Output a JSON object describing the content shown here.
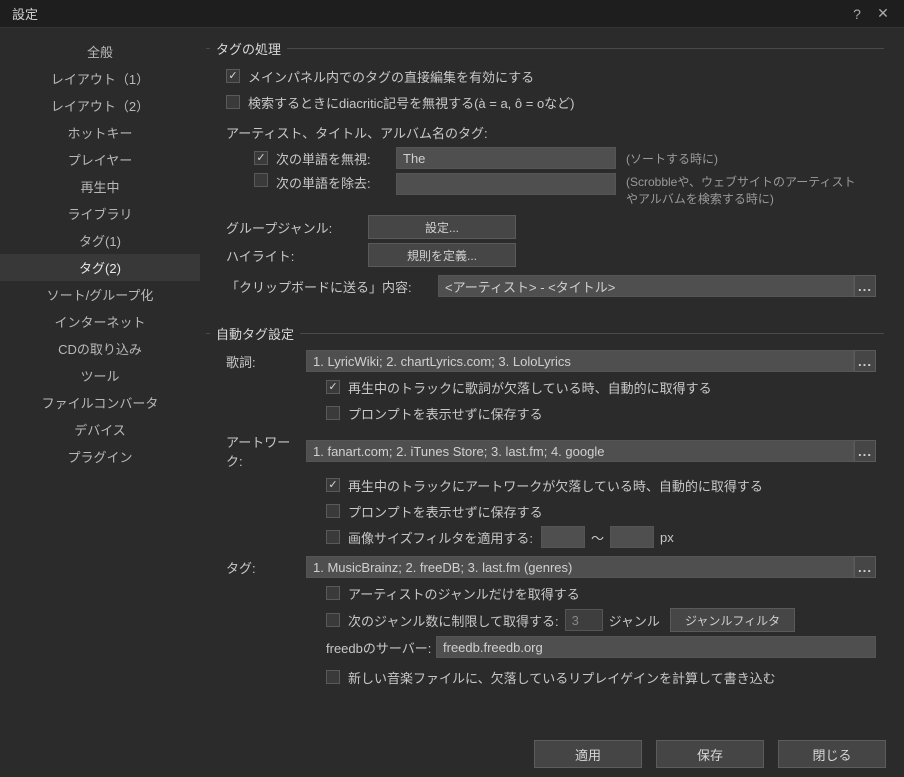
{
  "window": {
    "title": "設定"
  },
  "sidebar": {
    "items": [
      {
        "label": "全般"
      },
      {
        "label": "レイアウト（1）"
      },
      {
        "label": "レイアウト（2）"
      },
      {
        "label": "ホットキー"
      },
      {
        "label": "プレイヤー"
      },
      {
        "label": "再生中"
      },
      {
        "label": "ライブラリ"
      },
      {
        "label": "タグ(1)"
      },
      {
        "label": "タグ(2)"
      },
      {
        "label": "ソート/グループ化"
      },
      {
        "label": "インターネット"
      },
      {
        "label": "CDの取り込み"
      },
      {
        "label": "ツール"
      },
      {
        "label": "ファイルコンバータ"
      },
      {
        "label": "デバイス"
      },
      {
        "label": "プラグイン"
      }
    ],
    "selected_index": 8
  },
  "group_tag_processing": {
    "title": "タグの処理",
    "cb_direct_edit": "メインパネル内でのタグの直接編集を有効にする",
    "cb_ignore_diacritic": "検索するときにdiacritic記号を無視する(à = a, ô = oなど)",
    "artist_title_album_label": "アーティスト、タイトル、アルバム名のタグ:",
    "cb_ignore_word": "次の単語を無視:",
    "ignore_word_value": "The",
    "hint_sort": "(ソートする時に)",
    "cb_remove_word": "次の単語を除去:",
    "remove_word_value": "",
    "hint_scrobble": "(Scrobbleや、ウェブサイトのアーティストやアルバムを検索する時に)",
    "group_genre_label": "グループジャンル:",
    "btn_settei": "設定...",
    "highlight_label": "ハイライト:",
    "btn_define_rules": "規則を定義...",
    "clipboard_label": "「クリップボードに送る」内容:",
    "clipboard_value": "<アーティスト> - <タイトル>"
  },
  "group_auto_tag": {
    "title": "自動タグ設定",
    "lyrics_label": "歌詞:",
    "lyrics_value": "1. LyricWiki; 2. chartLyrics.com; 3. LoloLyrics",
    "cb_lyrics_auto": "再生中のトラックに歌詞が欠落している時、自動的に取得する",
    "cb_lyrics_noprompt": "プロンプトを表示せずに保存する",
    "artwork_label": "アートワーク:",
    "artwork_value": "1. fanart.com; 2. iTunes Store; 3. last.fm; 4. google",
    "cb_artwork_auto": "再生中のトラックにアートワークが欠落している時、自動的に取得する",
    "cb_artwork_noprompt": "プロンプトを表示せずに保存する",
    "cb_size_filter": "画像サイズフィルタを適用する:",
    "size_from": "",
    "size_to": "",
    "size_tilde": "〜",
    "size_unit": "px",
    "tag_label": "タグ:",
    "tag_value": "1. MusicBrainz; 2. freeDB; 3. last.fm (genres)",
    "cb_artist_genre_only": "アーティストのジャンルだけを取得する",
    "cb_genre_limit": "次のジャンル数に制限して取得する:",
    "genre_limit_value": "3",
    "genre_unit": "ジャンル",
    "btn_genre_filter": "ジャンルフィルタ",
    "freedb_server_label": "freedbのサーバー:",
    "freedb_server_value": "freedb.freedb.org",
    "cb_replaygain": "新しい音楽ファイルに、欠落しているリプレイゲインを計算して書き込む"
  },
  "footer": {
    "apply": "適用",
    "save": "保存",
    "close": "閉じる"
  }
}
